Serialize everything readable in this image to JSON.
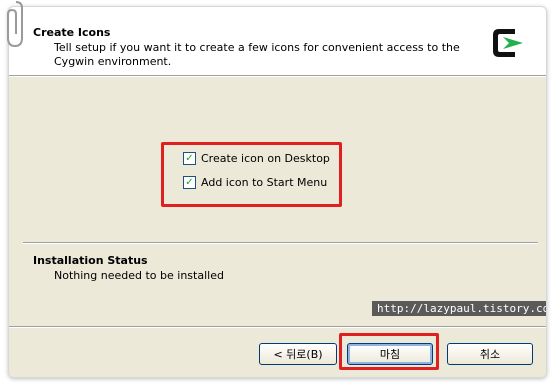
{
  "header": {
    "title": "Create Icons",
    "description": "Tell setup if you want it to create a few icons for convenient access to the Cygwin environment."
  },
  "options": [
    {
      "label": "Create icon on Desktop",
      "checked": true
    },
    {
      "label": "Add icon to Start Menu",
      "checked": true
    }
  ],
  "status": {
    "title": "Installation Status",
    "text": "Nothing needed to be installed"
  },
  "watermark": "http://lazypaul.tistory.com",
  "buttons": {
    "back": "< 뒤로(B)",
    "finish": "마침",
    "cancel": "취소"
  },
  "colors": {
    "highlight_box": "#e02020",
    "dialog_bg": "#ece9d8",
    "logo_accent": "#22b14c"
  },
  "icons": {
    "logo": "cygwin-logo-icon",
    "clip": "paperclip-icon"
  }
}
